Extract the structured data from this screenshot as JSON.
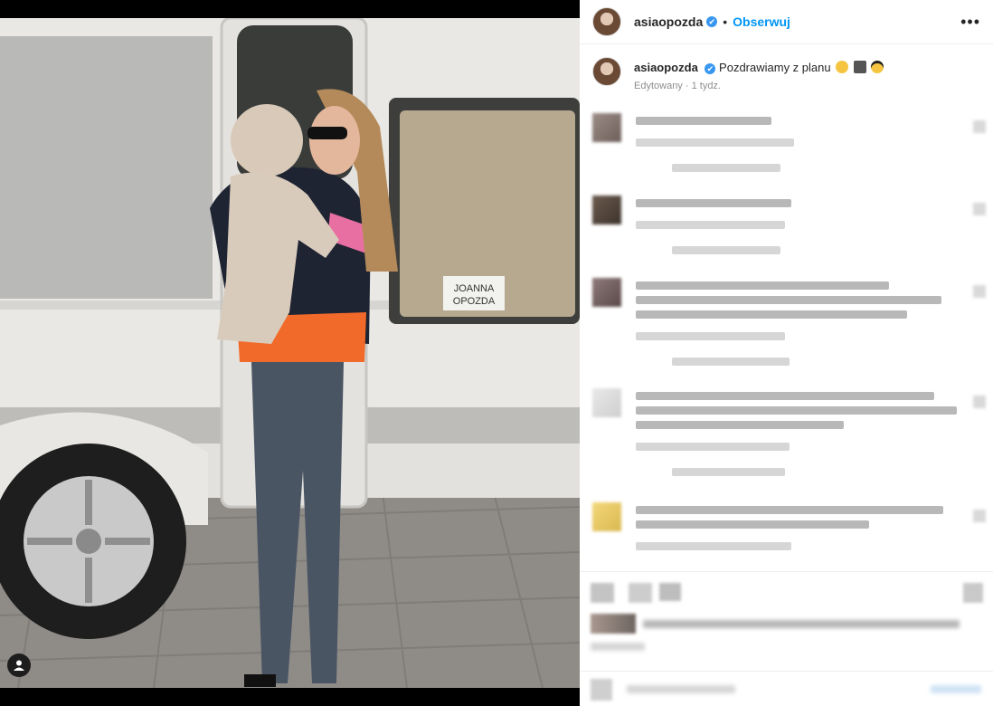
{
  "post": {
    "username": "asiaopozda",
    "verified_mark": "✔",
    "follow_label": "Obserwuj",
    "more_label": "•••",
    "caption_text": "Pozdrawiamy z planu",
    "caption_meta": "Edytowany · 1 tydz.",
    "trailer_sign": [
      "JOANNA",
      "OPOZDA"
    ]
  },
  "icons": {
    "tag": "user-tag-icon",
    "more": "more-options-icon",
    "verified": "verified-badge-icon"
  },
  "colors": {
    "link": "#0095f6",
    "verified": "#3897f0",
    "text": "#262626",
    "meta": "#8e8e8e"
  }
}
